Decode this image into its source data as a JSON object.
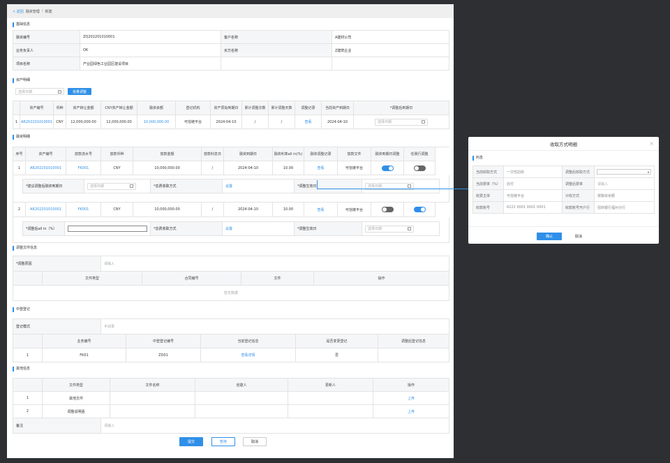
{
  "breadcrumb": {
    "back": "< 返回",
    "level1": "融资管理",
    "sep": "/",
    "level2": "新建"
  },
  "basic": {
    "title": "基础信息",
    "rows": [
      {
        "l1": "融资编号",
        "v1": "ZQ202201010001",
        "l2": "客户名称",
        "v2": "A建材公司"
      },
      {
        "l1": "业务负责人",
        "v1": "OK",
        "l2": "买方名称",
        "v2": "Z建筑企业"
      },
      {
        "l1": "项目名称",
        "v1": "产业园绿色工业园区建设项目",
        "l2": "",
        "v2": ""
      }
    ]
  },
  "assets": {
    "title": "资产明细",
    "date_placeholder": "选择日期",
    "batch_button": "批量调整",
    "headers": [
      "",
      "资产编号",
      "币种",
      "资产转让金额",
      "CNY资产转让金额",
      "融资余额",
      "登记机构",
      "资产原始到期日",
      "累计调整次数",
      "累计调整天数",
      "调整记录",
      "当前资产到期日",
      "*调整后到期日"
    ],
    "row": {
      "idx": "1",
      "asset_no": "AR202201010001",
      "currency": "CNY",
      "amount": "12,000,000.00",
      "cny_amount": "12,000,000.00",
      "balance": "10,000,000.00",
      "org": "可信链平台",
      "orig_due": "2024-04-10",
      "adj_times": "/",
      "adj_days": "/",
      "record": "查看",
      "current_due": "2024-04-10",
      "new_due_placeholder": "选择日期"
    }
  },
  "financing": {
    "title": "融资明细",
    "headers": [
      "序号",
      "资产编号",
      "放款流水号",
      "放款币种",
      "放款金额",
      "放款利息日",
      "融资到期日",
      "融资利率all in(%)",
      "融资调整记录",
      "放款文件",
      "融资到期日调整",
      "任我行调整"
    ],
    "rows": [
      {
        "idx": "1",
        "asset_no": "AR202201010001",
        "loan_no": "FK001",
        "currency": "CNY",
        "amount": "10,000,000.00",
        "interest_day": "/",
        "due": "2024-04-10",
        "rate": "10.00",
        "record": "查看",
        "file": "可信链平台",
        "due_adj": "on",
        "rate_adj": "off"
      },
      {
        "idx": "2",
        "asset_no": "AR202201010001",
        "loan_no": "FK001",
        "currency": "CNY",
        "amount": "10,000,000.00",
        "interest_day": "/",
        "due": "2024-04-10",
        "rate": "10.00",
        "record": "查看",
        "file": "可信链平台",
        "due_adj": "off",
        "rate_adj": "on"
      }
    ],
    "sub1": {
      "l1": "*建议调整后融资到期日",
      "p1": "选择日期",
      "l2": "*息费收取方式",
      "v2": "设置",
      "l3": "*调整生效日",
      "p3": "选择日期"
    },
    "sub2": {
      "l1": "*调整后all in（%）",
      "l2": "*息费收取方式",
      "v2": "设置",
      "l3": "*调整生效日",
      "p3": "选择日期"
    }
  },
  "adjust_files": {
    "title": "调整文件信息",
    "reason_label": "*调整原因",
    "reason_placeholder": "请输入",
    "headers": [
      "",
      "文件类型",
      "合同编号",
      "文件",
      "操作"
    ],
    "empty": "暂无数据"
  },
  "registry": {
    "title": "中登登记",
    "method_label": "登记模式",
    "method_placeholder": "手动录",
    "headers": [
      "",
      "业务编号",
      "中登登记编号",
      "当前登记信息",
      "是否变更登记",
      "调整后登记信息"
    ],
    "row": {
      "idx": "1",
      "biz_no": "FK01",
      "reg_no": "ZD01",
      "current": "查看详情",
      "changed": "否",
      "after": ""
    }
  },
  "other": {
    "title": "其他信息",
    "headers": [
      "",
      "文件类型",
      "文件名称",
      "创建人",
      "更新人",
      "操作"
    ],
    "rows": [
      {
        "idx": "1",
        "type": "其他文件",
        "op": "上传"
      },
      {
        "idx": "2",
        "type": "调整说明函",
        "op": "上传"
      }
    ],
    "remark_label": "备注",
    "remark_placeholder": "请输入"
  },
  "footer": {
    "submit": "提交",
    "save": "暂存",
    "cancel": "取消"
  },
  "modal": {
    "title": "收取方式明细",
    "close": "×",
    "section": "利息",
    "rows": [
      {
        "l1": "当前收取方式",
        "v1": "一次性后收",
        "l2": "调整后收取方式",
        "v2": ""
      },
      {
        "l1": "当前费率（%）",
        "v1": "后付",
        "l2": "调整后费率",
        "v2": "请输入"
      },
      {
        "l1": "收费主体",
        "v1": "可信链平台",
        "l2": "计收方式",
        "v2": "按融资余额"
      },
      {
        "l1": "收款账号",
        "v1": "6222 0001 0001 0001",
        "l2": "收款账号开户行",
        "v2": "招商银行福州分行"
      }
    ],
    "confirm": "确认",
    "cancel": "取消"
  },
  "colors": {
    "accent": "#2f8fe8",
    "background": "#2d2f33",
    "header_bg": "#f5f6f8"
  }
}
